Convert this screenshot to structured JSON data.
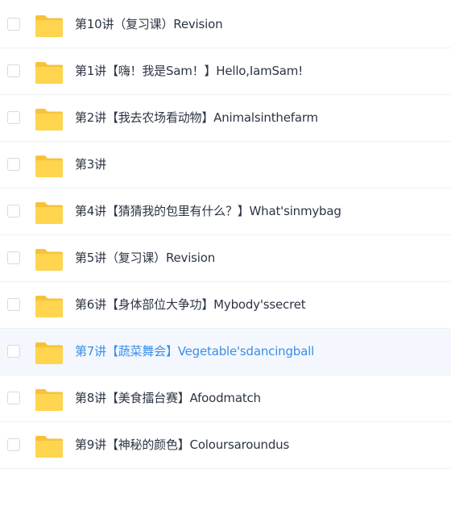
{
  "files": [
    {
      "name": "第10讲（复习课）Revision",
      "icon": "folder-icon",
      "selected": false
    },
    {
      "name": "第1讲【嗨！我是Sam！】Hello,IamSam!",
      "icon": "folder-icon",
      "selected": false
    },
    {
      "name": "第2讲【我去农场看动物】Animalsinthefarm",
      "icon": "folder-icon",
      "selected": false
    },
    {
      "name": "第3讲",
      "icon": "folder-icon",
      "selected": false
    },
    {
      "name": "第4讲【猜猜我的包里有什么？】What'sinmybag",
      "icon": "folder-icon",
      "selected": false
    },
    {
      "name": "第5讲（复习课）Revision",
      "icon": "folder-icon",
      "selected": false
    },
    {
      "name": "第6讲【身体部位大争功】Mybody'ssecret",
      "icon": "folder-icon",
      "selected": false
    },
    {
      "name": "第7讲【蔬菜舞会】Vegetable'sdancingball",
      "icon": "folder-icon",
      "selected": true
    },
    {
      "name": "第8讲【美食擂台赛】Afoodmatch",
      "icon": "folder-icon",
      "selected": false
    },
    {
      "name": "第9讲【神秘的颜色】Coloursaroundus",
      "icon": "folder-icon",
      "selected": false
    }
  ],
  "colors": {
    "folder_back": "#f7c23a",
    "folder_front": "#ffd44f",
    "selected_text": "#3a8ee8",
    "text": "#2c3443",
    "selected_row_bg": "#f4f8fe"
  }
}
